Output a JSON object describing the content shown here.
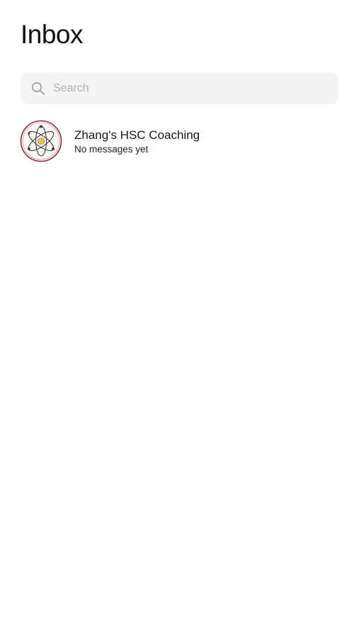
{
  "header": {
    "title": "Inbox"
  },
  "search": {
    "placeholder": "Search",
    "value": "",
    "icon": "search-icon"
  },
  "conversations": [
    {
      "name": "Zhang's HSC Coaching",
      "preview": "No messages yet",
      "avatar_icon": "atom-logo-avatar"
    }
  ],
  "colors": {
    "background": "#ffffff",
    "search_background": "#f4f4f4",
    "placeholder": "#b3b3b3",
    "avatar_ring": "#8b2a3a",
    "avatar_center": "#e2c84a"
  }
}
